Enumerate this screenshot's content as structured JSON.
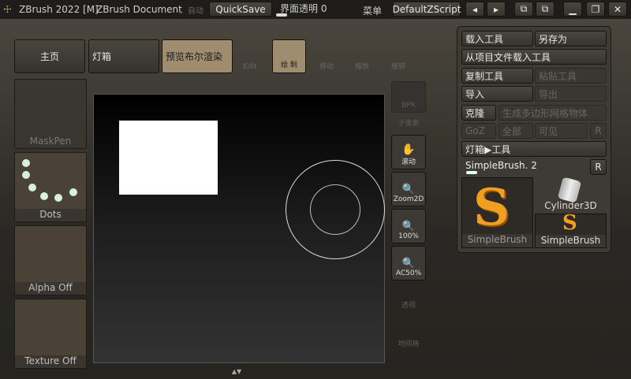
{
  "titlebar": {
    "app_title": "ZBrush 2022 [M]",
    "document": "ZBrush Document",
    "auto": "，自动",
    "quicksave": "QuickSave",
    "transparency": "界面透明 0",
    "menu": "菜单",
    "script": "DefaultZScript"
  },
  "top": {
    "home": "主页",
    "lightbox": "灯箱",
    "preview": "预览布尔渲染",
    "edit": "Edit",
    "draw": "绘 制",
    "move": "移动",
    "scale": "缩放",
    "rotate": "旋转"
  },
  "left": {
    "tiles": [
      "MaskPen",
      "Dots",
      "Alpha Off",
      "Texture Off"
    ]
  },
  "rightbar": {
    "bpr": "BPR",
    "subpixel": "子像素",
    "scroll": "滚动",
    "zoom2d": "Zoom2D",
    "zoom100": "100%",
    "ac50": "AC50%",
    "persp": "透视",
    "floor": "地网格"
  },
  "tool": {
    "load": "载入工具",
    "save_as": "另存为",
    "load_project": "从项目文件载入工具",
    "copy": "复制工具",
    "paste": "粘贴工具",
    "import": "导入",
    "export": "导出",
    "clone": "克隆",
    "make_polymesh": "生成多边形网格物体",
    "goz": "GoZ",
    "all": "全部",
    "visible": "可见",
    "r": "R",
    "lightbox_tool": "灯箱▶工具",
    "current": "SimpleBrush. 2",
    "current_r": "R",
    "thumbs": [
      "SimpleBrush",
      "Cylinder3D",
      "SimpleBrush"
    ]
  }
}
